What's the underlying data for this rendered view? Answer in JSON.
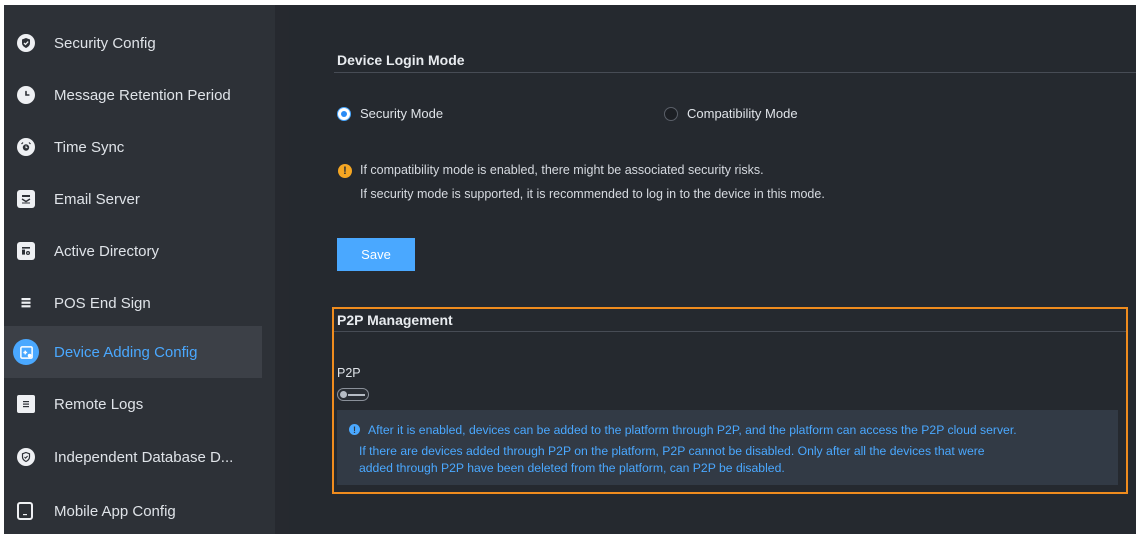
{
  "sidebar": {
    "items": [
      {
        "label": "Security Config",
        "icon": "shield-check-icon"
      },
      {
        "label": "Message Retention Period",
        "icon": "clock-icon"
      },
      {
        "label": "Time Sync",
        "icon": "alarm-clock-icon"
      },
      {
        "label": "Email Server",
        "icon": "email-server-icon"
      },
      {
        "label": "Active Directory",
        "icon": "directory-icon"
      },
      {
        "label": "POS End Sign",
        "icon": "pos-list-icon"
      },
      {
        "label": "Device Adding Config",
        "icon": "device-add-icon",
        "active": true
      },
      {
        "label": "Remote Logs",
        "icon": "log-document-icon"
      },
      {
        "label": "Independent Database D...",
        "icon": "database-shield-icon"
      },
      {
        "label": "Mobile App Config",
        "icon": "mobile-phone-icon"
      }
    ]
  },
  "login_mode": {
    "title": "Device Login Mode",
    "option_security": "Security Mode",
    "option_compatibility": "Compatibility Mode",
    "selected": "Security Mode",
    "note_line1": "If compatibility mode is enabled, there might be associated security risks.",
    "note_line2": "If security mode is supported, it is recommended to log in to the device in this mode.",
    "save_label": "Save"
  },
  "p2p": {
    "title": "P2P Management",
    "label": "P2P",
    "enabled": false,
    "info_line1": "After it is enabled, devices can be added to the platform through P2P,  and the platform can access the P2P cloud server.",
    "info_line2": "If there are devices added through P2P on the platform, P2P cannot be disabled. Only after all the devices that were",
    "info_line3": "added through P2P have been deleted from the platform, can P2P be disabled."
  },
  "colors": {
    "accent": "#4aa8ff",
    "warning": "#f5a623",
    "highlight": "#f08c1e",
    "background": "#25292f",
    "sidebar": "#2d3137"
  }
}
